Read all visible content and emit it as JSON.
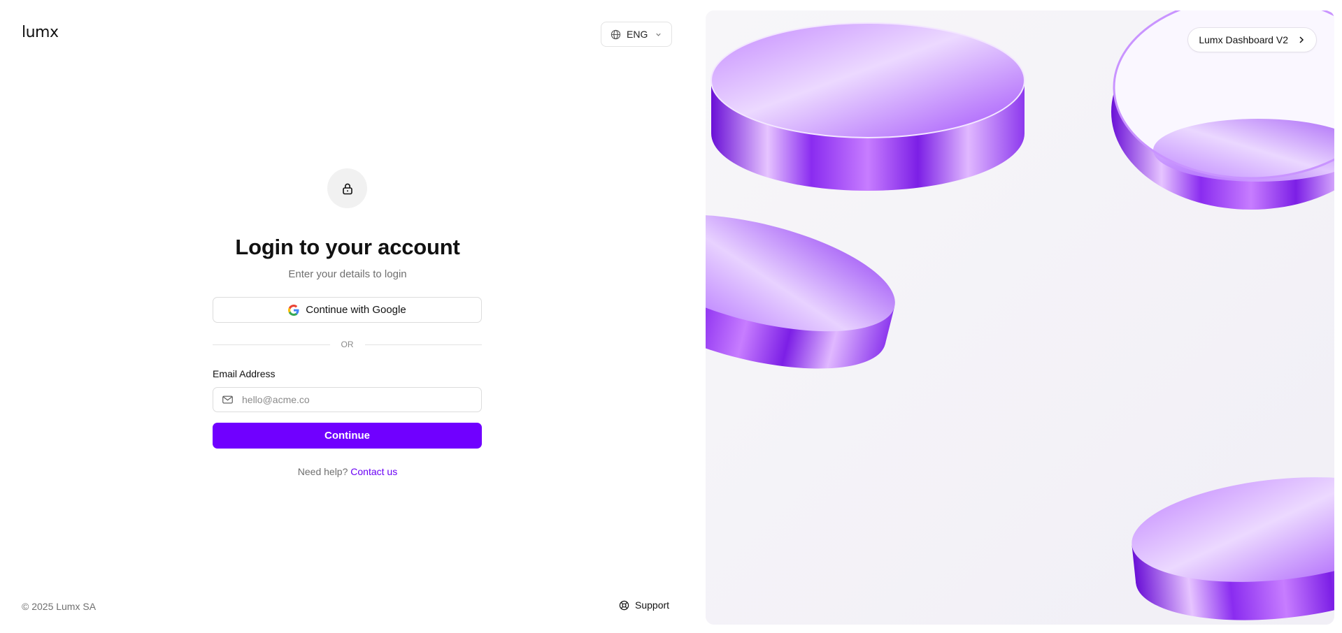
{
  "brand": {
    "logo_text": "lumx",
    "accent_color": "#7000ff"
  },
  "header": {
    "language": {
      "selected": "ENG",
      "icon": "globe-icon"
    }
  },
  "login": {
    "icon": "lock-icon",
    "title": "Login to your account",
    "subtitle": "Enter your details to login",
    "google_button_label": "Continue with Google",
    "divider_text": "OR",
    "email": {
      "label": "Email Address",
      "placeholder": "hello@acme.co",
      "value": "",
      "icon": "mail-icon"
    },
    "continue_button_label": "Continue",
    "help_text": "Need help?",
    "contact_link_label": "Contact us"
  },
  "footer": {
    "copyright": "© 2025 Lumx SA",
    "support_label": "Support",
    "support_icon": "lifebuoy-icon"
  },
  "side_panel": {
    "dashboard_button_label": "Lumx Dashboard V2",
    "dashboard_button_icon": "chevron-right-icon",
    "artwork": "purple-glass-discs"
  }
}
